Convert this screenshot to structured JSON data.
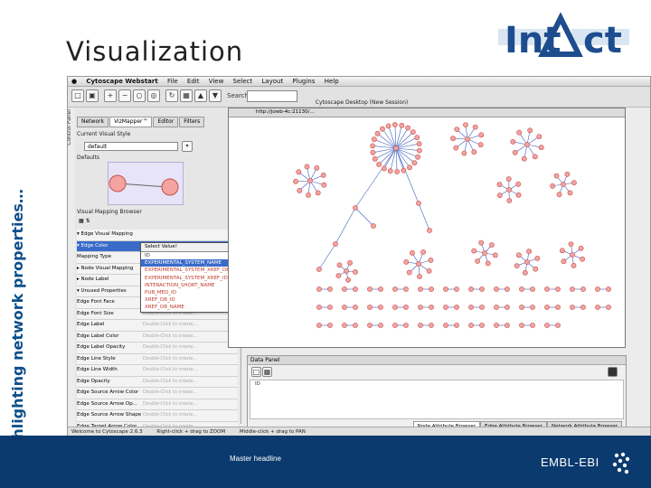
{
  "slide": {
    "title": "Visualization",
    "vertical_title": "Highlighting network properties…",
    "footer_text": "Master headline",
    "footer_logo": "EMBL-EBI",
    "brand_logo": "IntAct"
  },
  "app": {
    "menu": [
      "Cytoscape Webstart",
      "File",
      "Edit",
      "View",
      "Select",
      "Layout",
      "Plugins",
      "Help"
    ],
    "window_title": "Cytoscape Desktop (New Session)",
    "search_label": "Search:",
    "control_panel_label": "Control Panel",
    "tabs": [
      "Network",
      "VizMapper™",
      "Editor",
      "Filters"
    ],
    "current_visual_style_label": "Current Visual Style",
    "current_visual_style_value": "default",
    "defaults_label": "Defaults",
    "visual_mapping_browser_label": "Visual Mapping Browser",
    "url": "http://jowb-4c:21130/...",
    "status_left": "Welcome to Cytoscape 2.6.3",
    "status_mid": "Right-click + drag to ZOOM",
    "status_right": "Middle-click + drag to PAN",
    "data_panel_label": "Data Panel",
    "data_panel_id": "ID",
    "data_tabs": [
      "Node Attribute Browser",
      "Edge Attribute Browser",
      "Network Attribute Browser"
    ]
  },
  "mapping_rows": [
    {
      "label": "▾ Edge Visual Mapping",
      "value": ""
    },
    {
      "label": "▾ Edge Color",
      "value": "Select Value!"
    },
    {
      "label": "   Mapping Type",
      "value": ""
    },
    {
      "label": "▸ Node Visual Mapping",
      "value": ""
    },
    {
      "label": "▸ Node Label",
      "value": ""
    },
    {
      "label": "▾ Unused Properties",
      "value": ""
    },
    {
      "label": "Edge Font Face",
      "value": "Double-Click to create..."
    },
    {
      "label": "Edge Font Size",
      "value": "Double-Click to create..."
    },
    {
      "label": "Edge Label",
      "value": "Double-Click to create..."
    },
    {
      "label": "Edge Label Color",
      "value": "Double-Click to create..."
    },
    {
      "label": "Edge Label Opacity",
      "value": "Double-Click to create..."
    },
    {
      "label": "Edge Line Style",
      "value": "Double-Click to create..."
    },
    {
      "label": "Edge Line Width",
      "value": "Double-Click to create..."
    },
    {
      "label": "Edge Opacity",
      "value": "Double-Click to create..."
    },
    {
      "label": "Edge Source Arrow Color",
      "value": "Double-Click to create..."
    },
    {
      "label": "Edge Source Arrow Op...",
      "value": "Double-Click to create..."
    },
    {
      "label": "Edge Source Arrow Shape",
      "value": "Double-Click to create..."
    },
    {
      "label": "Edge Target Arrow Color",
      "value": "Double-Click to create..."
    }
  ],
  "dropdown": {
    "selected_label": "Select Value!",
    "items": [
      "ID",
      "EXPERIMENTAL_SYSTEM_NAME",
      "EXPERIMENTAL_SYSTEM_XREF_DB",
      "EXPERIMENTAL_SYSTEM_XREF_ID",
      "INTERACTION_SHORT_NAME",
      "PUB_MED_ID",
      "XREF_DB_ID",
      "XREF_DB_NAME"
    ]
  },
  "colors": {
    "title_blue": "#0b4f8a",
    "footer_bg": "#0a3a6e",
    "node_fill": "#f4a3a0",
    "node_stroke": "#c0504d",
    "edge": "#3f5fbf"
  }
}
